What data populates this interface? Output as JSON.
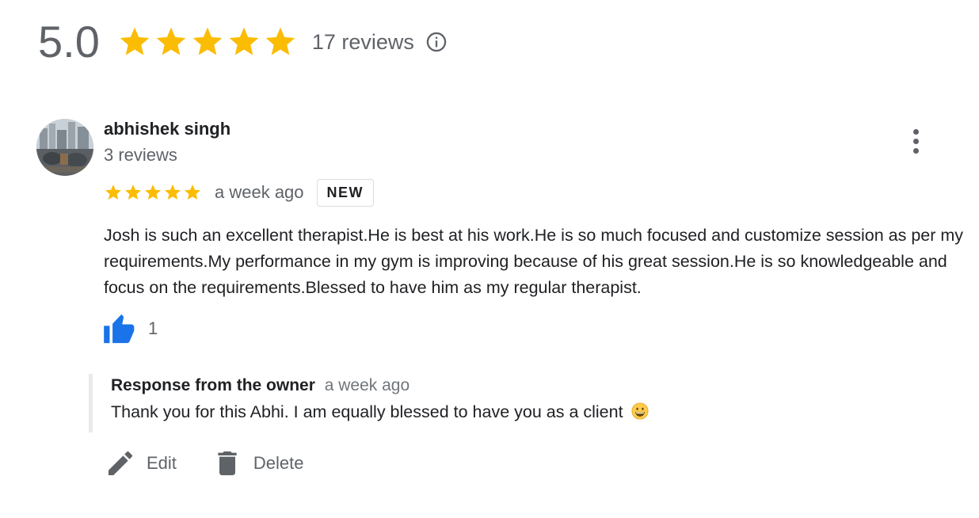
{
  "summary": {
    "rating": "5.0",
    "stars": 5,
    "review_count": "17 reviews",
    "info_icon": "info-icon",
    "star_color": "#FBBC04"
  },
  "review": {
    "author": "abhishek singh",
    "author_meta": "3 reviews",
    "avatar_icon": "avatar-photo",
    "stars": 5,
    "time": "a week ago",
    "badge": "NEW",
    "text": "Josh is such an excellent therapist.He is best at his work.He is so much focused and customize session as per my requirements.My performance in my gym is improving because of his great session.He is so knowledgeable and focus on the requirements.Blessed to have him as my regular therapist.",
    "likes": "1",
    "like_color": "#1A73E8",
    "more_icon": "more-vert-icon"
  },
  "owner_response": {
    "label": "Response from the owner",
    "time": "a week ago",
    "text": "Thank you for this Abhi. I am equally blessed to have you as a client",
    "emoji": "grinning-face-emoji"
  },
  "actions": {
    "edit_label": "Edit",
    "delete_label": "Delete",
    "edit_icon": "pencil-icon",
    "delete_icon": "trash-icon"
  }
}
